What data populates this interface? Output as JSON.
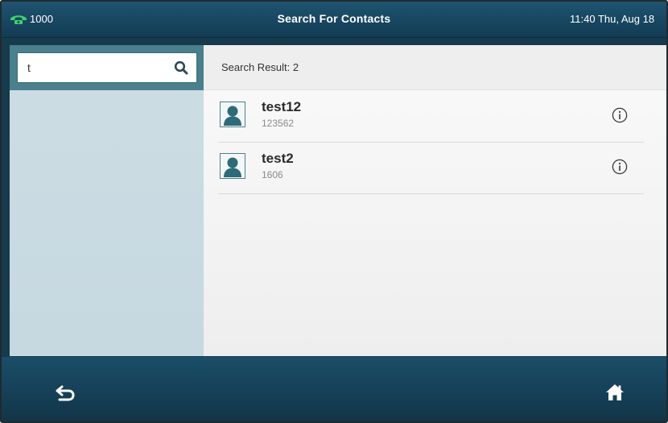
{
  "status_bar": {
    "line_label": "1000",
    "title": "Search For Contacts",
    "clock": "11:40 Thu, Aug 18",
    "line_icon": "phone-handset-icon",
    "line_icon_color": "#3fd36b"
  },
  "search": {
    "value": "t",
    "icon": "search-icon"
  },
  "results": {
    "header": "Search Result: 2",
    "contacts": [
      {
        "name": "test12",
        "number": "123562",
        "icon": "contact-avatar-icon",
        "action_icon": "info-icon"
      },
      {
        "name": "test2",
        "number": "1606",
        "icon": "contact-avatar-icon",
        "action_icon": "info-icon"
      }
    ]
  },
  "bottom_bar": {
    "back_icon": "back-arrow-icon",
    "home_icon": "home-icon"
  },
  "colors": {
    "header_bg": "#184660",
    "search_frame": "#4a7f8c",
    "left_panel": "#c6d8e0",
    "accent_teal": "#2f6a78"
  }
}
